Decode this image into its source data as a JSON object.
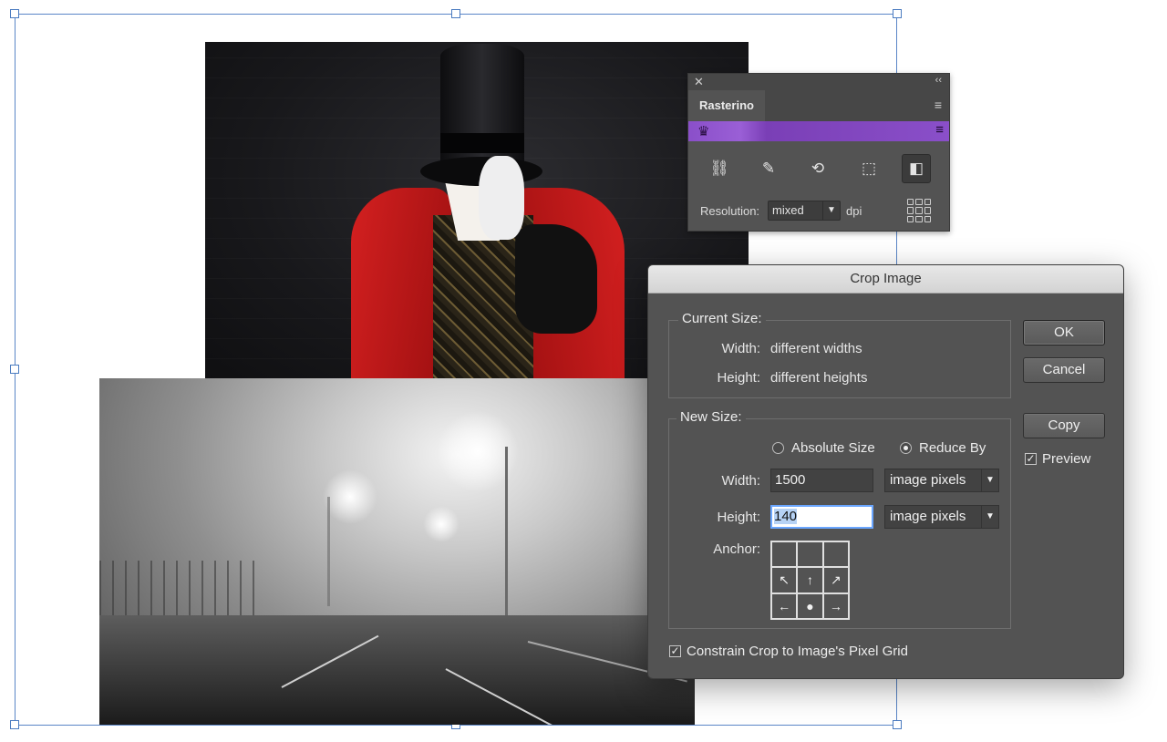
{
  "rasterino": {
    "close_glyph": "✕",
    "collapse_glyph": "‹‹",
    "tab_label": "Rasterino",
    "menu_glyph": "≡",
    "brand_icon": "crown-icon",
    "tools": [
      {
        "icon": "link-image-icon",
        "glyph": "⛓"
      },
      {
        "icon": "brush-image-icon",
        "glyph": "✎"
      },
      {
        "icon": "rotate-image-icon",
        "glyph": "⟲"
      },
      {
        "icon": "crop-frame-icon",
        "glyph": "⬚"
      },
      {
        "icon": "split-image-icon",
        "glyph": "◧"
      }
    ],
    "resolution_label": "Resolution:",
    "resolution_value": "mixed",
    "dpi_label": "dpi"
  },
  "dialog": {
    "title": "Crop Image",
    "current_size": {
      "title": "Current Size:",
      "width_label": "Width:",
      "width_value": "different widths",
      "height_label": "Height:",
      "height_value": "different heights"
    },
    "new_size": {
      "title": "New Size:",
      "option_absolute": "Absolute Size",
      "option_reduce": "Reduce By",
      "selected_option": "Reduce By",
      "width_label": "Width:",
      "width_value": "1500",
      "width_unit": "image pixels",
      "height_label": "Height:",
      "height_value": "140",
      "height_unit": "image pixels",
      "anchor_label": "Anchor:",
      "anchor_cells": [
        "",
        "",
        "",
        "↖",
        "↑",
        "↗",
        "←",
        "●",
        "→"
      ]
    },
    "constrain_label": "Constrain Crop to Image's Pixel Grid",
    "constrain_checked": true,
    "buttons": {
      "ok": "OK",
      "cancel": "Cancel",
      "copy": "Copy"
    },
    "preview_label": "Preview",
    "preview_checked": true,
    "check_glyph": "✓",
    "dropdown_glyph": "▼"
  }
}
